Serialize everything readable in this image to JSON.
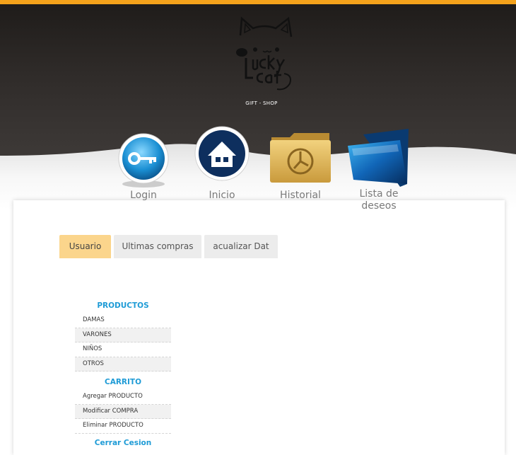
{
  "colors": {
    "accent": "#f4a21b",
    "header_dark": "#2f2b29",
    "link_blue": "#1e9bd6",
    "active_tab": "#fbd58c"
  },
  "logo": {
    "text": "Lucky Cat",
    "subtitle": "GIFT - SHOP"
  },
  "nav": [
    {
      "label": "Login",
      "icon": "key-icon"
    },
    {
      "label": "Inicio",
      "icon": "home-icon"
    },
    {
      "label": "Historial",
      "icon": "clock-folder-icon"
    },
    {
      "label_line1": "Lista de",
      "label_line2": "deseos",
      "icon": "blue-folder-icon"
    }
  ],
  "tabs": [
    {
      "label": "Usuario",
      "active": true
    },
    {
      "label": "Ultimas compras",
      "active": false
    },
    {
      "label": "acualizar Dat",
      "active": false
    }
  ],
  "sidebar": {
    "productos_heading": "PRODUCTOS",
    "productos": [
      "DAMAS",
      "VARONES",
      "NIÑOS",
      "OTROS"
    ],
    "carrito_heading": "CARRITO",
    "carrito": [
      "Agregar PRODUCTO",
      "Modificar COMPRA",
      "Eliminar PRODUCTO"
    ],
    "logout": "Cerrar Cesion"
  }
}
